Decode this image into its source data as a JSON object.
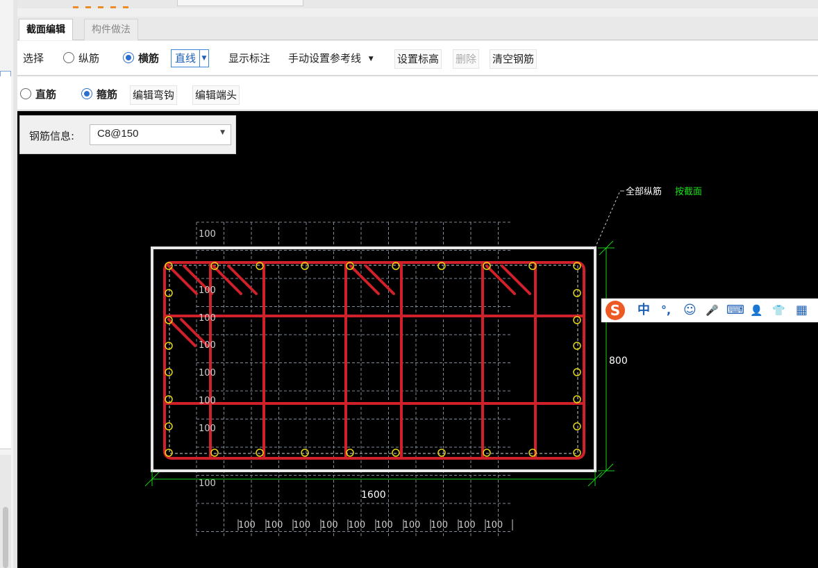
{
  "tabs": {
    "active": "截面编辑",
    "inactive": "构件做法"
  },
  "toolbar1": {
    "select": "选择",
    "radio_longitudinal": "纵筋",
    "radio_transverse": "横筋",
    "line_type": "直线",
    "show_annotation": "显示标注",
    "manual_reference": "手动设置参考线",
    "set_elevation": "设置标高",
    "delete": "删除",
    "clear_rebar": "清空钢筋"
  },
  "toolbar2": {
    "radio_straight": "直筋",
    "radio_stirrup": "箍筋",
    "edit_hook": "编辑弯钩",
    "edit_end": "编辑端头"
  },
  "rebar_info": {
    "label": "钢筋信息:",
    "value": "C8@150"
  },
  "drawing": {
    "annotation_prefix": "全部纵筋",
    "annotation_link": "按截面",
    "width_dim": "1600",
    "height_dim": "800",
    "grid_label": "100",
    "bottom_grid_labels": [
      "100",
      "100",
      "100",
      "100",
      "100",
      "100",
      "100",
      "100",
      "100",
      "100"
    ],
    "colors": {
      "background": "#000000",
      "rebar": "#d0202a",
      "frame": "#e8e8e8",
      "dimension": "#19d119",
      "bars": "#e6d619",
      "link": "#19e019"
    }
  },
  "ime": {
    "logo": "S",
    "items": [
      "中",
      "°,",
      "☺",
      "🎤",
      "⌨",
      "👤",
      "👕",
      "▦"
    ]
  }
}
